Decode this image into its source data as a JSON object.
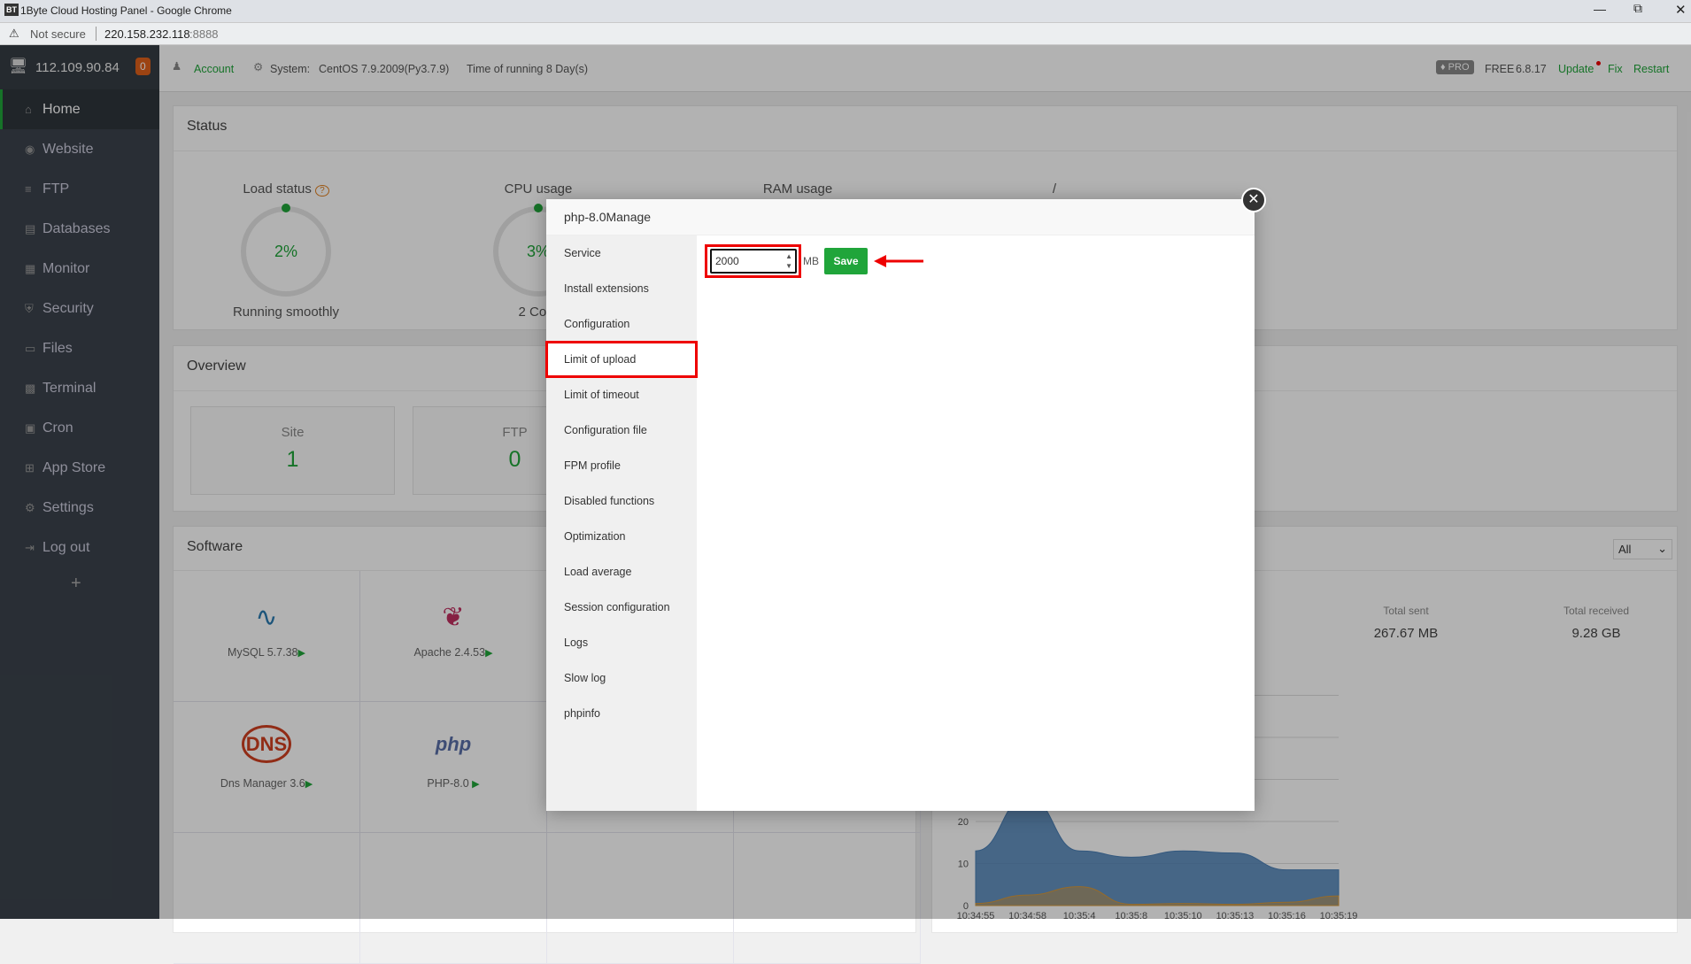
{
  "browser": {
    "title": "1Byte Cloud Hosting Panel - Google Chrome",
    "favicon": "BT",
    "security": "Not secure",
    "url_host": "220.158.232.118",
    "url_port": ":8888"
  },
  "sidebar": {
    "server_ip": "112.109.90.84",
    "badge": "0",
    "items": [
      {
        "label": "Home",
        "icon": "home-icon"
      },
      {
        "label": "Website",
        "icon": "globe-icon"
      },
      {
        "label": "FTP",
        "icon": "ftp-icon"
      },
      {
        "label": "Databases",
        "icon": "database-icon"
      },
      {
        "label": "Monitor",
        "icon": "monitor-icon"
      },
      {
        "label": "Security",
        "icon": "shield-icon"
      },
      {
        "label": "Files",
        "icon": "folder-icon"
      },
      {
        "label": "Terminal",
        "icon": "terminal-icon"
      },
      {
        "label": "Cron",
        "icon": "calendar-icon"
      },
      {
        "label": "App Store",
        "icon": "grid-icon"
      },
      {
        "label": "Settings",
        "icon": "gear-icon"
      },
      {
        "label": "Log out",
        "icon": "logout-icon"
      }
    ],
    "add": "+"
  },
  "header": {
    "account": "Account",
    "system_label": "System:",
    "system": "CentOS 7.9.2009(Py3.7.9)",
    "running": "Time of running 8 Day(s)",
    "pro": "PRO",
    "free": "FREE",
    "version": "6.8.17",
    "update": "Update",
    "fix": "Fix",
    "restart": "Restart"
  },
  "status": {
    "title": "Status",
    "gauges": [
      {
        "label": "Load status",
        "value": "2%",
        "sub": "Running smoothly",
        "percent": 2
      },
      {
        "label": "CPU usage",
        "value": "3%",
        "sub": "2 Core",
        "percent": 3
      },
      {
        "label": "RAM usage"
      },
      {
        "label": "/"
      }
    ]
  },
  "overview": {
    "title": "Overview",
    "cards": [
      {
        "label": "Site",
        "value": "1"
      },
      {
        "label": "FTP",
        "value": "0"
      }
    ]
  },
  "software": {
    "title": "Software",
    "items": [
      {
        "name": "MySQL 5.7.38"
      },
      {
        "name": "Apache 2.4.53"
      },
      {
        "name": "Dns Manager 3.6"
      },
      {
        "name": "PHP-8.0 "
      }
    ]
  },
  "traffic": {
    "select": "All",
    "total_sent_label": "Total sent",
    "total_sent": "267.67 MB",
    "total_received_label": "Total received",
    "total_received": "9.28 GB"
  },
  "chart_data": {
    "type": "area",
    "x": [
      "10:34:55",
      "10:34:58",
      "10:35:4",
      "10:35:8",
      "10:35:10",
      "10:35:13",
      "10:35:16",
      "10:35:19"
    ],
    "yticks": [
      "0",
      "10",
      "20"
    ],
    "ylim": [
      0,
      50
    ],
    "grid": true,
    "series": [
      {
        "values": [
          13,
          26,
          13,
          11.5,
          13,
          12.5,
          8.5,
          8.5
        ],
        "color": "#4a7fb5"
      },
      {
        "values": [
          0.5,
          2.5,
          4.5,
          0.3,
          0.5,
          0.3,
          0.8,
          2.3
        ],
        "color": "#d89a3a"
      }
    ]
  },
  "modal": {
    "title": "php-8.0Manage",
    "menu": [
      "Service",
      "Install extensions",
      "Configuration",
      "Limit of upload",
      "Limit of timeout",
      "Configuration file",
      "FPM profile",
      "Disabled functions",
      "Optimization",
      "Load average",
      "Session configuration",
      "Logs",
      "Slow log",
      "phpinfo"
    ],
    "active": "Limit of upload",
    "upload_value": "2000",
    "unit": "MB",
    "save": "Save"
  },
  "colors": {
    "accent": "#20a53a",
    "highlight": "#e00000"
  }
}
